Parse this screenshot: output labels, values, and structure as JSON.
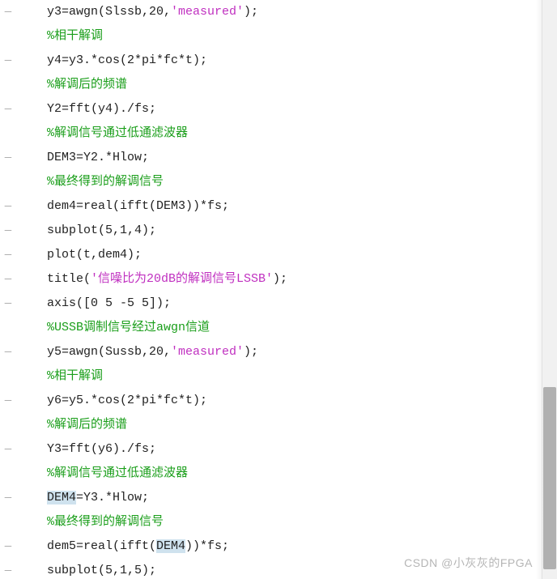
{
  "watermark": "CSDN @小灰灰的FPGA",
  "gutter_dash": "—",
  "lines": [
    {
      "dash": true,
      "tokens": [
        {
          "cls": "c-default",
          "t": "y3=awgn(Slssb,20,"
        },
        {
          "cls": "c-string",
          "t": "'measured'"
        },
        {
          "cls": "c-default",
          "t": ");"
        }
      ]
    },
    {
      "dash": false,
      "tokens": [
        {
          "cls": "c-comment",
          "t": "%相干解调"
        }
      ]
    },
    {
      "dash": true,
      "tokens": [
        {
          "cls": "c-default",
          "t": "y4=y3.*cos(2*pi*fc*t);"
        }
      ]
    },
    {
      "dash": false,
      "tokens": [
        {
          "cls": "c-comment",
          "t": "%解调后的频谱"
        }
      ]
    },
    {
      "dash": true,
      "tokens": [
        {
          "cls": "c-default",
          "t": "Y2=fft(y4)./fs;"
        }
      ]
    },
    {
      "dash": false,
      "tokens": [
        {
          "cls": "c-comment",
          "t": "%解调信号通过低通滤波器"
        }
      ]
    },
    {
      "dash": true,
      "tokens": [
        {
          "cls": "c-default",
          "t": "DEM3=Y2.*Hlow;"
        }
      ]
    },
    {
      "dash": false,
      "tokens": [
        {
          "cls": "c-comment",
          "t": "%最终得到的解调信号"
        }
      ]
    },
    {
      "dash": true,
      "tokens": [
        {
          "cls": "c-default",
          "t": "dem4=real(ifft(DEM3))*fs;"
        }
      ]
    },
    {
      "dash": true,
      "tokens": [
        {
          "cls": "c-default",
          "t": "subplot(5,1,4);"
        }
      ]
    },
    {
      "dash": true,
      "tokens": [
        {
          "cls": "c-default",
          "t": "plot(t,dem4);"
        }
      ]
    },
    {
      "dash": true,
      "tokens": [
        {
          "cls": "c-default",
          "t": "title("
        },
        {
          "cls": "c-string",
          "t": "'信噪比为20dB的解调信号LSSB'"
        },
        {
          "cls": "c-default",
          "t": ");"
        }
      ]
    },
    {
      "dash": true,
      "tokens": [
        {
          "cls": "c-default",
          "t": "axis([0 5 -5 5]);"
        }
      ]
    },
    {
      "dash": false,
      "tokens": [
        {
          "cls": "c-comment",
          "t": "%USSB调制信号经过awgn信道"
        }
      ]
    },
    {
      "dash": true,
      "tokens": [
        {
          "cls": "c-default",
          "t": "y5=awgn(Sussb,20,"
        },
        {
          "cls": "c-string",
          "t": "'measured'"
        },
        {
          "cls": "c-default",
          "t": ");"
        }
      ]
    },
    {
      "dash": false,
      "tokens": [
        {
          "cls": "c-comment",
          "t": "%相干解调"
        }
      ]
    },
    {
      "dash": true,
      "tokens": [
        {
          "cls": "c-default",
          "t": "y6=y5.*cos(2*pi*fc*t);"
        }
      ]
    },
    {
      "dash": false,
      "tokens": [
        {
          "cls": "c-comment",
          "t": "%解调后的频谱"
        }
      ]
    },
    {
      "dash": true,
      "tokens": [
        {
          "cls": "c-default",
          "t": "Y3=fft(y6)./fs;"
        }
      ]
    },
    {
      "dash": false,
      "tokens": [
        {
          "cls": "c-comment",
          "t": "%解调信号通过低通滤波器"
        }
      ]
    },
    {
      "dash": true,
      "tokens": [
        {
          "cls": "c-default c-highlight",
          "t": "DEM4"
        },
        {
          "cls": "c-default",
          "t": "=Y3.*Hlow;"
        }
      ]
    },
    {
      "dash": false,
      "tokens": [
        {
          "cls": "c-comment",
          "t": "%最终得到的解调信号"
        }
      ]
    },
    {
      "dash": true,
      "tokens": [
        {
          "cls": "c-default",
          "t": "dem5=real(ifft("
        },
        {
          "cls": "c-default c-highlight",
          "t": "DEM4"
        },
        {
          "cls": "c-default",
          "t": "))*fs;"
        }
      ]
    },
    {
      "dash": true,
      "tokens": [
        {
          "cls": "c-default",
          "t": "subplot(5,1,5);"
        }
      ]
    }
  ]
}
